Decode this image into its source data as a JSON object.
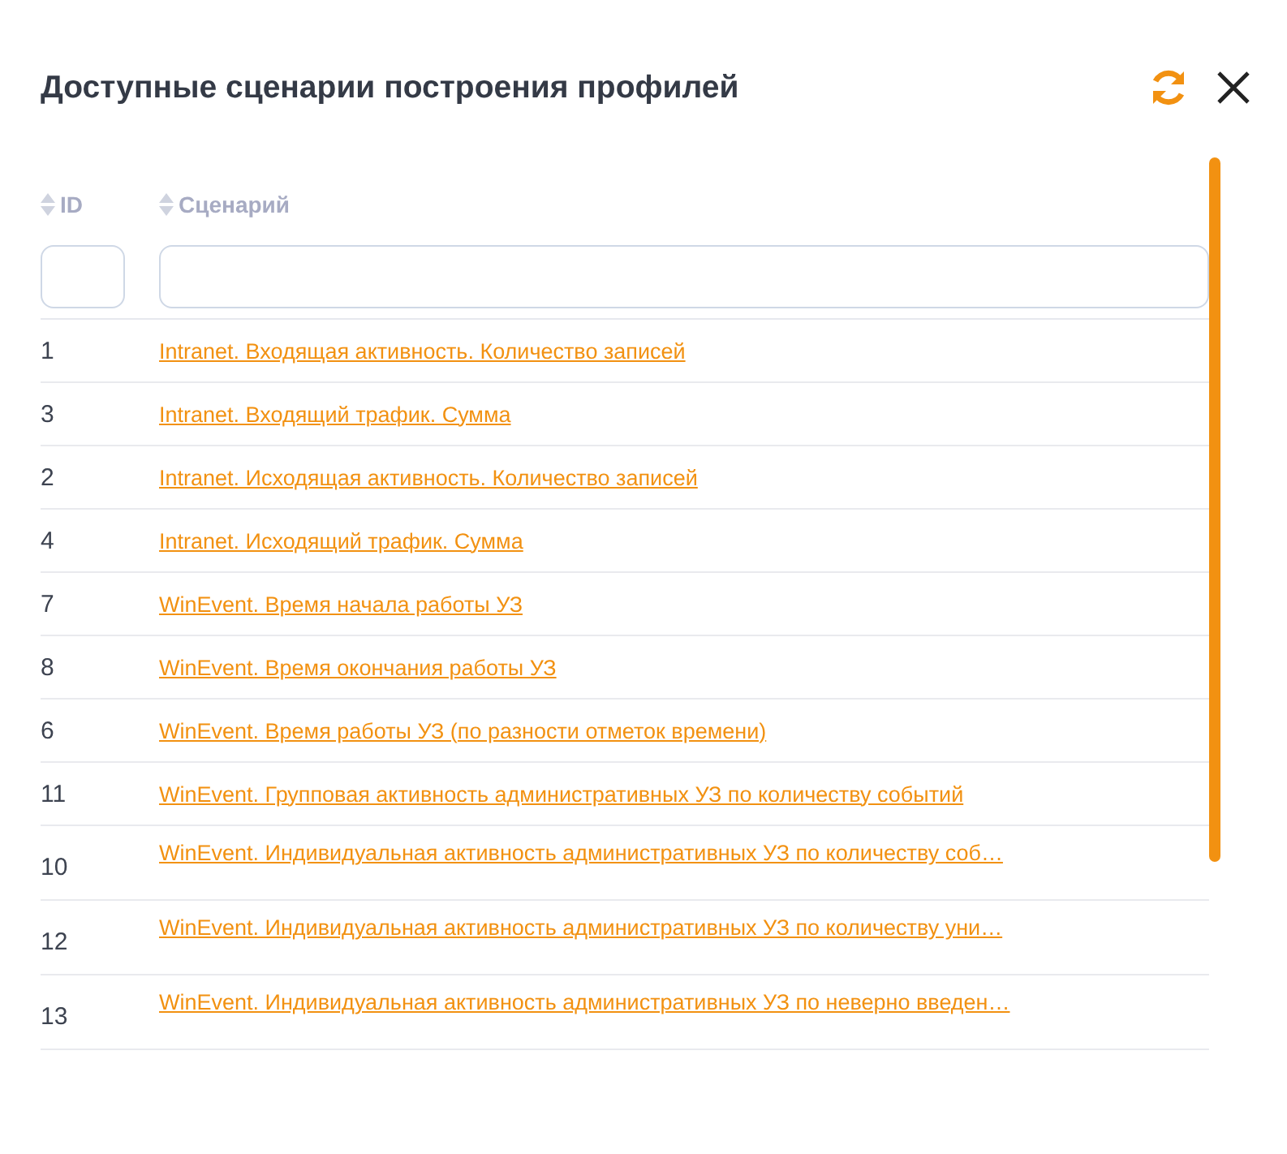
{
  "dialog": {
    "title": "Доступные сценарии построения профилей"
  },
  "table": {
    "columns": [
      {
        "label": "ID"
      },
      {
        "label": "Сценарий"
      }
    ],
    "rows": [
      {
        "id": "1",
        "scenario": "Intranet. Входящая активность. Количество записей",
        "tall": false
      },
      {
        "id": "3",
        "scenario": "Intranet. Входящий трафик. Сумма",
        "tall": false
      },
      {
        "id": "2",
        "scenario": "Intranet. Исходящая активность. Количество записей",
        "tall": false
      },
      {
        "id": "4",
        "scenario": "Intranet. Исходящий трафик. Сумма",
        "tall": false
      },
      {
        "id": "7",
        "scenario": "WinEvent. Время начала работы УЗ",
        "tall": false
      },
      {
        "id": "8",
        "scenario": "WinEvent. Время окончания работы УЗ",
        "tall": false
      },
      {
        "id": "6",
        "scenario": "WinEvent. Время работы УЗ (по разности отметок времени)",
        "tall": false
      },
      {
        "id": "11",
        "scenario": "WinEvent. Групповая активность административных УЗ по количеству событий",
        "tall": false
      },
      {
        "id": "10",
        "scenario": "WinEvent. Индивидуальная активность административных УЗ по количеству соб…",
        "tall": true
      },
      {
        "id": "12",
        "scenario": "WinEvent. Индивидуальная активность административных УЗ по количеству уни…",
        "tall": true
      },
      {
        "id": "13",
        "scenario": "WinEvent. Индивидуальная активность административных УЗ по неверно введен…",
        "tall": true
      }
    ]
  }
}
